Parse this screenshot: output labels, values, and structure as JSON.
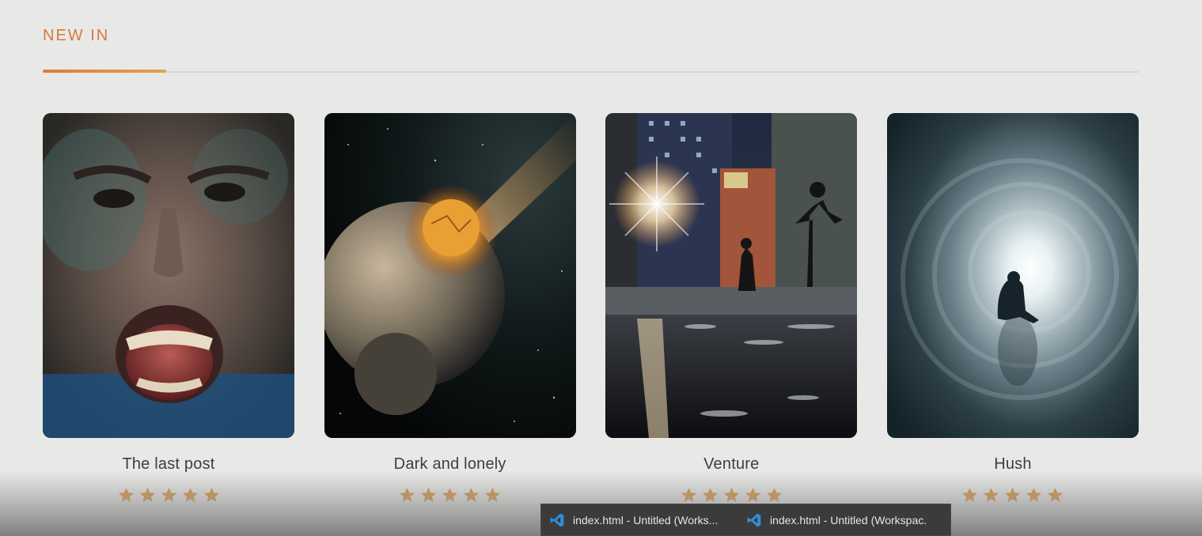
{
  "section": {
    "title": "NEW IN"
  },
  "cards": [
    {
      "title": "The last post",
      "rating": 5
    },
    {
      "title": "Dark and lonely",
      "rating": 5
    },
    {
      "title": "Venture",
      "rating": 5
    },
    {
      "title": "Hush",
      "rating": 5
    }
  ],
  "taskbar": {
    "items": [
      {
        "label": "index.html - Untitled (Works...",
        "icon": "vscode-icon"
      },
      {
        "label": "index.html - Untitled (Workspac...",
        "icon": "vscode-icon"
      }
    ]
  },
  "colors": {
    "accent": "#d9773f",
    "star": "#d9903f",
    "background": "#e8e9e6"
  }
}
